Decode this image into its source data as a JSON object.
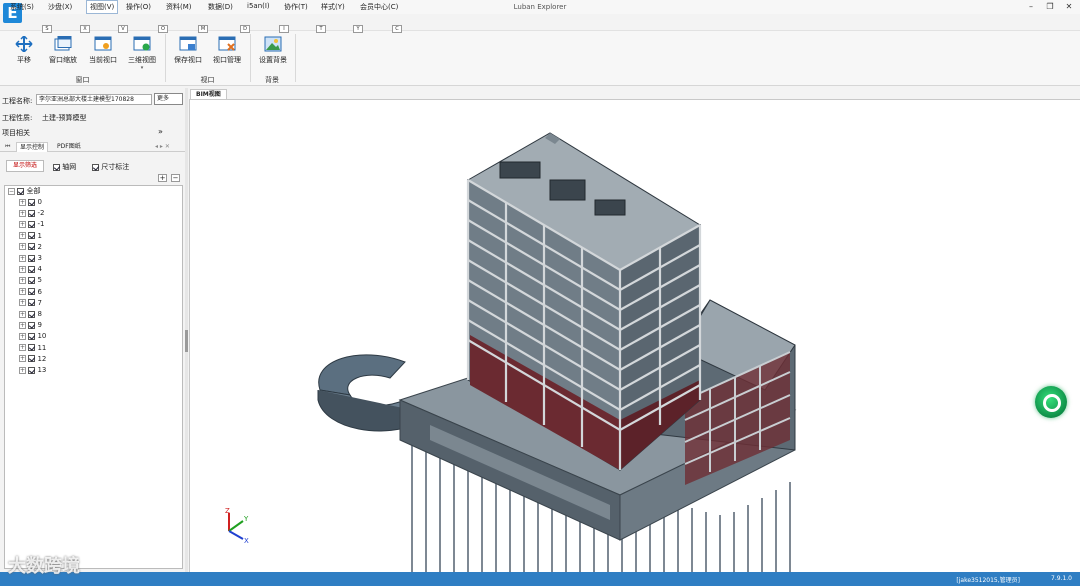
{
  "window": {
    "title": "Luban Explorer",
    "logo": "E"
  },
  "menu": [
    {
      "label": "系统(S)",
      "key": "S"
    },
    {
      "label": "沙盘(X)",
      "key": "X"
    },
    {
      "label": "视图(V)",
      "key": "V",
      "active": true
    },
    {
      "label": "操作(O)",
      "key": "O"
    },
    {
      "label": "资料(M)",
      "key": "M"
    },
    {
      "label": "数据(D)",
      "key": "D"
    },
    {
      "label": "i5an(I)",
      "key": "I"
    },
    {
      "label": "协作(T)",
      "key": "T"
    },
    {
      "label": "样式(Y)",
      "key": "Y"
    },
    {
      "label": "会员中心(C)",
      "key": "C"
    }
  ],
  "ribbon": {
    "buttons": [
      "平移",
      "窗口缩放",
      "当前视口",
      "三维视图",
      "保存视口",
      "视口管理",
      "设置背景"
    ],
    "groups": [
      "窗口",
      "视口",
      "背景"
    ]
  },
  "left": {
    "project_name_label": "工程名称:",
    "project_name_value": "李尔亚洲总部大楼土建模型170828",
    "more_button": "更多",
    "project_type_label": "工程性质:",
    "project_type_value": "土建-预算模型",
    "section_label": "项目相关",
    "tabs": [
      "显示控制",
      "PDF图纸"
    ],
    "filter_button": "显示筛选",
    "checkboxes": [
      "轴网",
      "尺寸标注"
    ],
    "tree_root": "全部",
    "floors": [
      "0",
      "-2",
      "-1",
      "1",
      "2",
      "3",
      "4",
      "5",
      "6",
      "7",
      "8",
      "9",
      "10",
      "11",
      "12",
      "13"
    ]
  },
  "viewport_tab": "BIM视图",
  "axes": {
    "x": "X",
    "y": "Y",
    "z": "Z"
  },
  "status": {
    "user": "[jake3512015,管理员]",
    "version": "7.9.1.0"
  },
  "watermark": "大数跨境",
  "colors": {
    "accent": "#2f7ec3",
    "float": "#1bb35c"
  }
}
